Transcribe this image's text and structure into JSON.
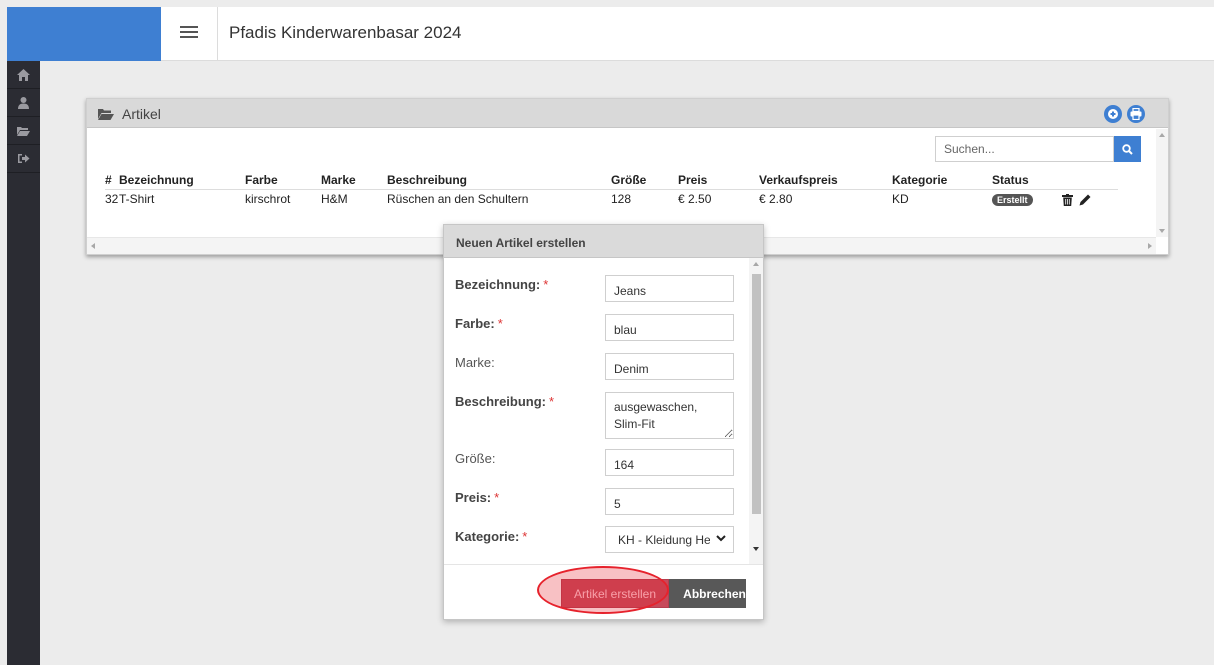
{
  "app": {
    "title": "Pfadis Kinderwarenbasar 2024"
  },
  "sidebar": {
    "items": [
      {
        "icon": "home-icon"
      },
      {
        "icon": "user-icon"
      },
      {
        "icon": "folder-open-icon"
      },
      {
        "icon": "sign-out-icon"
      }
    ]
  },
  "panel": {
    "title": "Artikel",
    "search_placeholder": "Suchen...",
    "columns": [
      "#",
      "Bezeichnung",
      "Farbe",
      "Marke",
      "Beschreibung",
      "Größe",
      "Preis",
      "Verkaufspreis",
      "Kategorie",
      "Status"
    ],
    "rows": [
      {
        "nr": "32",
        "bezeichnung": "T-Shirt",
        "farbe": "kirschrot",
        "marke": "H&M",
        "beschreibung": "Rüschen an den Schultern",
        "groesse": "128",
        "preis": "€ 2.50",
        "verkaufspreis": "€ 2.80",
        "kategorie": "KD",
        "status": "Erstellt"
      }
    ]
  },
  "modal": {
    "title": "Neuen Artikel erstellen",
    "required_mark": "*",
    "fields": {
      "bezeichnung": {
        "label": "Bezeichnung:",
        "value": "Jeans"
      },
      "farbe": {
        "label": "Farbe:",
        "value": "blau"
      },
      "marke": {
        "label": "Marke:",
        "value": "Denim"
      },
      "beschreibung": {
        "label": "Beschreibung:",
        "value": "ausgewaschen, Slim-Fit"
      },
      "groesse": {
        "label": "Größe:",
        "value": "164"
      },
      "preis": {
        "label": "Preis:",
        "value": "5"
      },
      "kategorie": {
        "label": "Kategorie:",
        "value": "KH - Kleidung Herren"
      }
    },
    "create_label": "Artikel erstellen",
    "cancel_label": "Abbrechen"
  },
  "colors": {
    "brand": "#3e7fd2",
    "sidebar": "#2b2c33",
    "create_button": "#c74a5b",
    "highlight": "#e6222c",
    "required": "#dd3333"
  }
}
